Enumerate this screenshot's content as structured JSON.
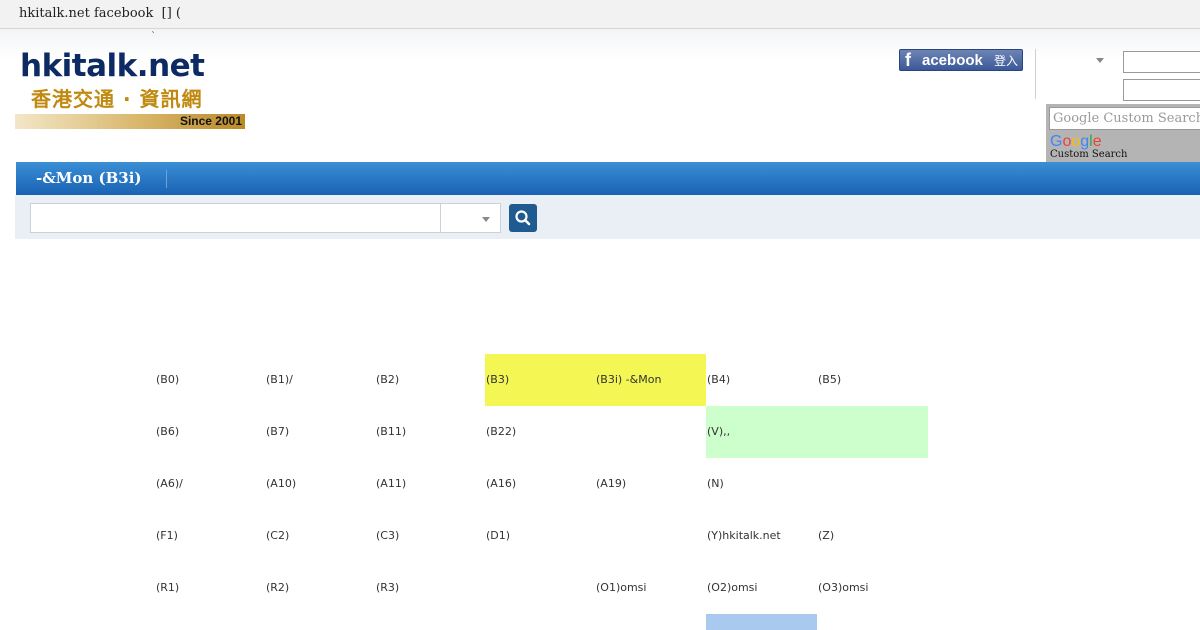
{
  "window": {
    "title": "hkitalk.net facebook  [] ("
  },
  "header_tick": "`",
  "logo": {
    "name": "hkitalk.net",
    "tagline": "香港交通 · 資訊網",
    "since": "Since 2001"
  },
  "facebook_login": {
    "f": "f",
    "brand": "acebook",
    "action": "登入"
  },
  "google_search": {
    "placeholder": "Google Custom Search",
    "caption": "Custom Search"
  },
  "nav": {
    "title": "-&Mon (B3i)"
  },
  "route_grid": {
    "rows": [
      [
        "(B0)",
        "(B1)/",
        "(B2)",
        "(B3)",
        "(B3i) -&Mon",
        "(B4)",
        "(B5)"
      ],
      [
        "(B6)",
        "(B7)",
        "(B11)",
        "(B22)",
        "",
        "(V),,",
        ""
      ],
      [
        "(A6)/",
        "(A10)",
        "(A11)",
        "(A16)",
        "(A19)",
        "(N)",
        ""
      ],
      [
        "(F1)",
        "(C2)",
        "(C3)",
        "(D1)",
        "",
        "(Y)hkitalk.net",
        "(Z)"
      ],
      [
        "(R1)",
        "(R2)",
        "(R3)",
        "",
        "(O1)omsi",
        "(O2)omsi",
        "(O3)omsi"
      ]
    ]
  },
  "colors": {
    "current_route": "#f4f753",
    "group_highlight": "#ccffcc",
    "nav_blue": "#1a62b3",
    "facebook_blue": "#3b5998"
  }
}
